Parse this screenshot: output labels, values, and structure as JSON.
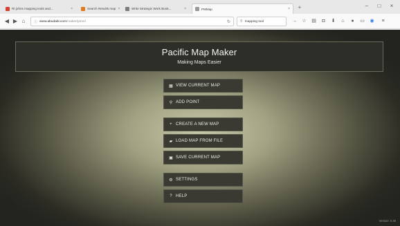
{
  "browser": {
    "tabs": [
      {
        "title": "RI johns mapping tools and...",
        "favicon_color": "#d0432e",
        "active": false
      },
      {
        "title": "Search Results map",
        "favicon_color": "#e37a1d",
        "active": false
      },
      {
        "title": "Write Strategic Work Book...",
        "favicon_color": "#7d7d7d",
        "active": false
      },
      {
        "title": "PMMap",
        "favicon_color": "#9a9a9a",
        "active": true
      }
    ],
    "url_domain": "www.abudabi.com",
    "url_path": "/maker/pmm/",
    "search_value": "mapping tool"
  },
  "app": {
    "title": "Pacific Map Maker",
    "subtitle": "Making Maps Easier",
    "buttons": [
      {
        "label": "VIEW CURRENT MAP",
        "icon": "map-icon",
        "glyph": "▦"
      },
      {
        "label": "ADD POINT",
        "icon": "map-marker-icon",
        "glyph": "⚲"
      },
      {
        "label": "CREATE A NEW MAP",
        "icon": "plus-icon",
        "glyph": "+"
      },
      {
        "label": "LOAD MAP FROM FILE",
        "icon": "folder-open-icon",
        "glyph": "▰"
      },
      {
        "label": "SAVE CURRENT MAP",
        "icon": "floppy-disk-icon",
        "glyph": "▣"
      },
      {
        "label": "SETTINGS",
        "icon": "gear-icon",
        "glyph": "⚙"
      },
      {
        "label": "HELP",
        "icon": "question-icon",
        "glyph": "?"
      }
    ],
    "version": "Version: 0.45"
  }
}
